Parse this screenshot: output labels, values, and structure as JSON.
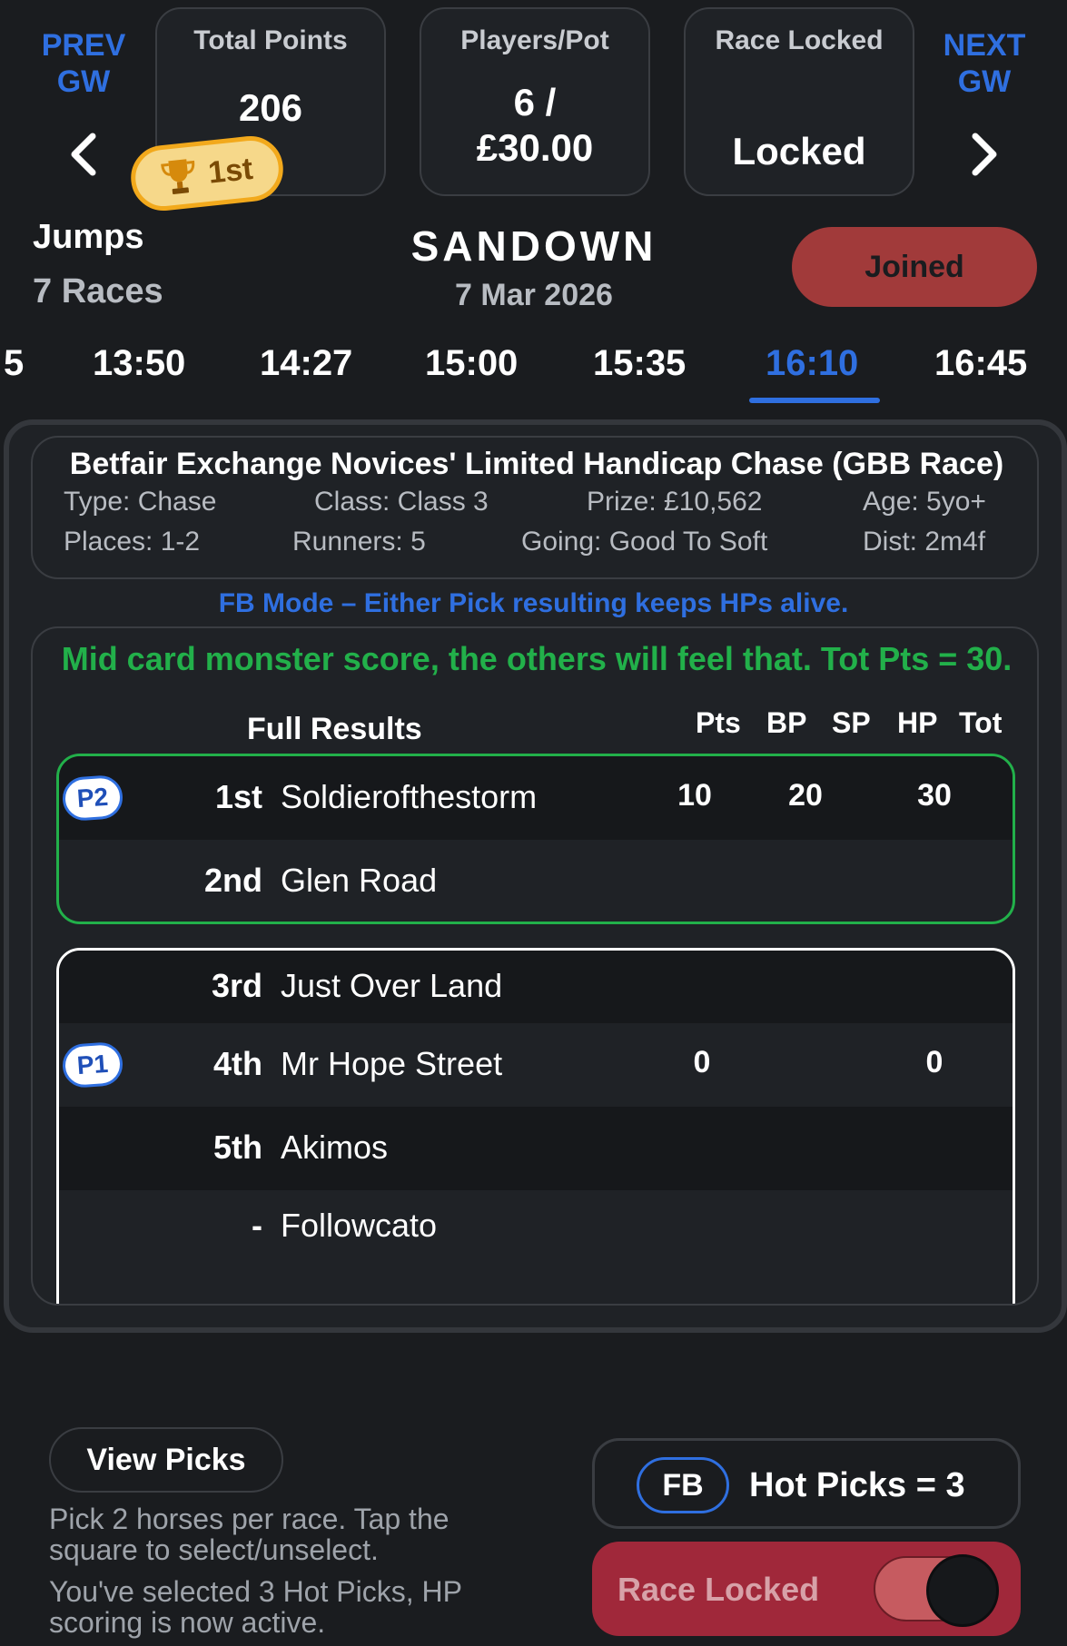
{
  "nav": {
    "prev_label_1": "PREV",
    "prev_label_2": "GW",
    "next_label_1": "NEXT",
    "next_label_2": "GW"
  },
  "stats": {
    "total_points_label": "Total Points",
    "total_points_value": "206",
    "players_pot_label": "Players/Pot",
    "players_pot_line1": "6 /",
    "players_pot_line2": "£30.00",
    "race_locked_label": "Race Locked",
    "race_locked_value": "Locked"
  },
  "rank_badge": "1st",
  "meeting": {
    "type": "Jumps",
    "races": "7 Races",
    "course": "SANDOWN",
    "date": "7 Mar 2026",
    "joined_label": "Joined"
  },
  "time_tabs": [
    "5",
    "13:50",
    "14:27",
    "15:00",
    "15:35",
    "16:10",
    "16:45"
  ],
  "active_tab": "16:10",
  "race": {
    "title": "Betfair Exchange Novices' Limited Handicap Chase (GBB Race)",
    "type": "Type: Chase",
    "class": "Class: Class 3",
    "prize": "Prize: £10,562",
    "age": "Age: 5yo+",
    "places": "Places: 1-2",
    "runners": "Runners: 5",
    "going": "Going: Good To Soft",
    "dist": "Dist: 2m4f"
  },
  "fb_mode_text": "FB Mode – Either Pick resulting keeps HPs alive.",
  "results": {
    "comment": "Mid card monster score, the others will feel that. Tot Pts = 30.",
    "heading": "Full Results",
    "columns": [
      "Pts",
      "BP",
      "SP",
      "HP",
      "Tot"
    ],
    "rows": [
      {
        "pick": "P2",
        "pos": "1st",
        "horse": "Soldierofthestorm",
        "pts": "10",
        "sp": "20",
        "tot": "30"
      },
      {
        "pick": "",
        "pos": "2nd",
        "horse": "Glen Road",
        "pts": "",
        "sp": "",
        "tot": ""
      },
      {
        "pick": "",
        "pos": "3rd",
        "horse": "Just Over Land",
        "pts": "",
        "sp": "",
        "tot": ""
      },
      {
        "pick": "P1",
        "pos": "4th",
        "horse": "Mr Hope Street",
        "pts": "0",
        "sp": "",
        "tot": "0"
      },
      {
        "pick": "",
        "pos": "5th",
        "horse": "Akimos",
        "pts": "",
        "sp": "",
        "tot": ""
      },
      {
        "pick": "",
        "pos": "-",
        "horse": "Followcato",
        "pts": "",
        "sp": "",
        "tot": ""
      }
    ]
  },
  "bottom": {
    "view_picks": "View Picks",
    "hint1_line1": "Pick 2 horses per race. Tap the",
    "hint1_line2": "square to select/unselect.",
    "hint2_line1": "You've selected 3 Hot Picks, HP",
    "hint2_line2": "scoring is now active.",
    "fb_label": "FB",
    "hot_picks": "Hot Picks = 3",
    "race_locked": "Race Locked"
  },
  "colors": {
    "accent_blue": "#2f6fe0",
    "green": "#22b04a",
    "joined_red": "#a13a3a",
    "locked_red": "#a0283a",
    "badge_gold": "#f2a91c"
  }
}
